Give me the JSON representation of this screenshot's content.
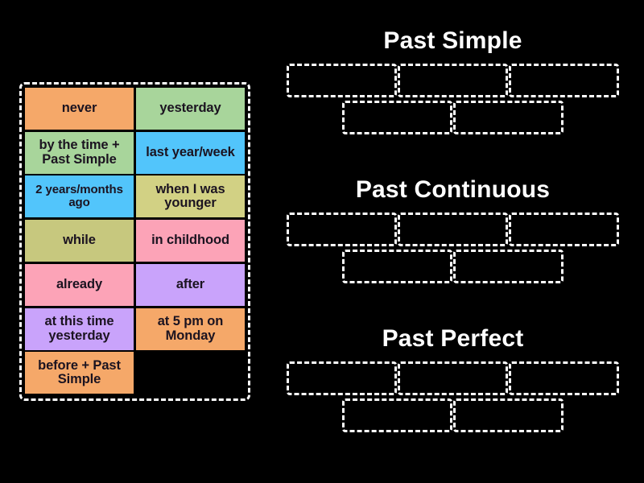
{
  "activity": {
    "type": "drag-and-drop-sorting",
    "background_color": "#000000"
  },
  "word_bank": {
    "border_color": "#ffffff",
    "tiles": [
      {
        "label": "never",
        "color": "#f5a869"
      },
      {
        "label": "yesterday",
        "color": "#a8d59b"
      },
      {
        "label": "by the time + Past Simple",
        "color": "#a8d59b"
      },
      {
        "label": "last year/week",
        "color": "#52c5fb"
      },
      {
        "label": "2 years/months ago",
        "color": "#52c5fb"
      },
      {
        "label": "when I was younger",
        "color": "#d2d184"
      },
      {
        "label": "while",
        "color": "#c7c87e"
      },
      {
        "label": "in childhood",
        "color": "#fca3b7"
      },
      {
        "label": "already",
        "color": "#fca3b7"
      },
      {
        "label": "after",
        "color": "#c9a3fb"
      },
      {
        "label": "at this time yesterday",
        "color": "#c9a3fb"
      },
      {
        "label": "at 5 pm on Monday",
        "color": "#f5a869"
      },
      {
        "label": "before + Past Simple",
        "color": "#f5a869"
      },
      {
        "label": "",
        "color": "transparent"
      }
    ]
  },
  "categories": [
    {
      "title": "Past Simple",
      "slots_row_1": [
        "",
        "",
        ""
      ],
      "slots_row_2": [
        "",
        ""
      ]
    },
    {
      "title": "Past Continuous",
      "slots_row_1": [
        "",
        "",
        ""
      ],
      "slots_row_2": [
        "",
        ""
      ]
    },
    {
      "title": "Past Perfect",
      "slots_row_1": [
        "",
        "",
        ""
      ],
      "slots_row_2": [
        "",
        ""
      ]
    }
  ]
}
